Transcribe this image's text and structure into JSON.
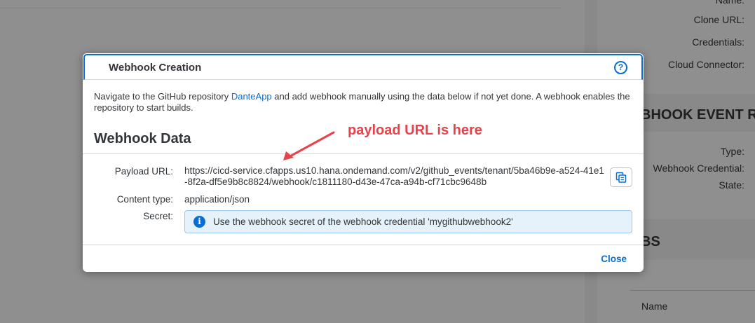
{
  "background": {
    "side_labels": [
      "Name:",
      "Clone URL:",
      "Credentials:",
      "Cloud Connector:"
    ],
    "event_section_title": "BHOOK EVENT R",
    "event_labels": [
      "Type:",
      "Webhook Credential:",
      "State:"
    ],
    "jobs_section_title": "BS",
    "table_header": "Name"
  },
  "dialog": {
    "title": "Webhook Creation",
    "help_icon": "help-circle-icon",
    "intro_before_link": "Navigate to the GitHub repository ",
    "intro_link": "DanteApp",
    "intro_after_link": " and add webhook manually using the data below if not yet done. A webhook enables the repository to start builds.",
    "section_title": "Webhook Data",
    "annotation": "payload URL is here",
    "payload_url_label": "Payload URL:",
    "payload_url_value": "https://cicd-service.cfapps.us10.hana.ondemand.com/v2/github_events/tenant/5ba46b9e-a524-41e1-8f2a-df5e9b8c8824/webhook/c1811180-d43e-47ca-a94b-cf71cbc9648b",
    "content_type_label": "Content type:",
    "content_type_value": "application/json",
    "secret_label": "Secret:",
    "secret_info": "Use the webhook secret of the webhook credential 'mygithubwebhook2'",
    "close_label": "Close"
  },
  "colors": {
    "accent": "#0a6ed1",
    "annotation": "#e8424a",
    "info_background": "#e6f2fb"
  }
}
